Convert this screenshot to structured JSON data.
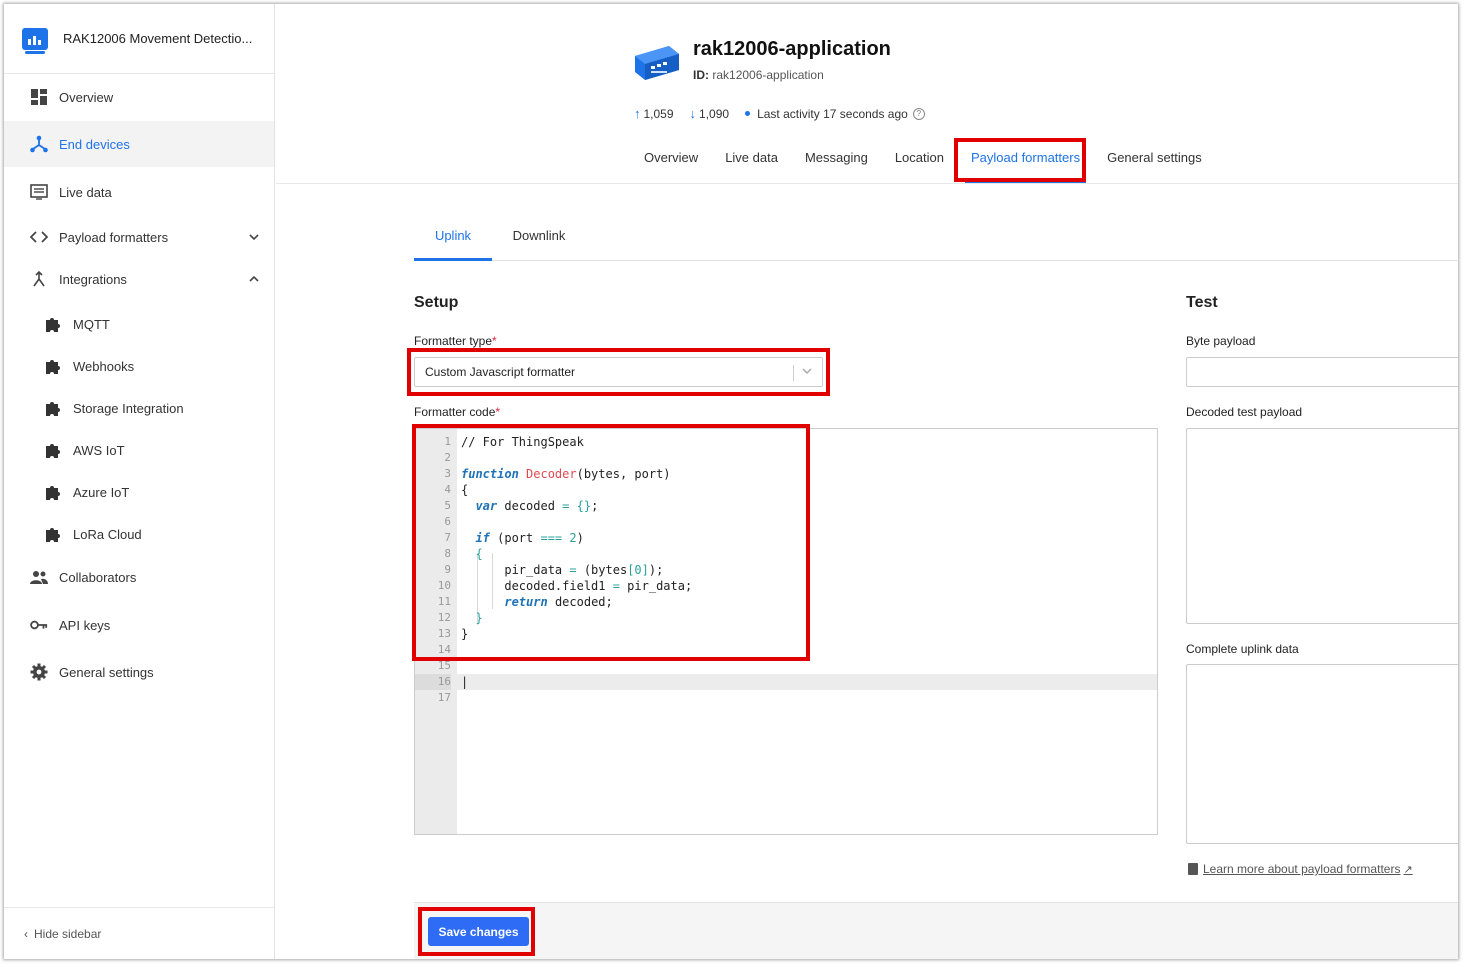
{
  "sidebar": {
    "app_name": "RAK12006 Movement Detectio...",
    "items": [
      {
        "label": "Overview",
        "icon": "dashboard-icon"
      },
      {
        "label": "End devices",
        "icon": "end-devices-icon"
      },
      {
        "label": "Live data",
        "icon": "live-data-icon"
      },
      {
        "label": "Payload formatters",
        "icon": "code-icon"
      },
      {
        "label": "Integrations",
        "icon": "integrations-icon"
      }
    ],
    "integrations": [
      {
        "label": "MQTT",
        "icon": "puzzle-icon"
      },
      {
        "label": "Webhooks",
        "icon": "puzzle-icon"
      },
      {
        "label": "Storage Integration",
        "icon": "puzzle-icon"
      },
      {
        "label": "AWS IoT",
        "icon": "puzzle-icon"
      },
      {
        "label": "Azure IoT",
        "icon": "puzzle-icon"
      },
      {
        "label": "LoRa Cloud",
        "icon": "puzzle-icon"
      }
    ],
    "bottom_items": [
      {
        "label": "Collaborators",
        "icon": "people-icon"
      },
      {
        "label": "API keys",
        "icon": "key-icon"
      },
      {
        "label": "General settings",
        "icon": "gear-icon"
      }
    ],
    "hide_label": "Hide sidebar"
  },
  "header": {
    "title": "rak12006-application",
    "id_label": "ID:",
    "id_value": "rak12006-application",
    "uplink_count": "1,059",
    "downlink_count": "1,090",
    "last_activity": "Last activity 17 seconds ago"
  },
  "tabs": [
    "Overview",
    "Live data",
    "Messaging",
    "Location",
    "Payload formatters",
    "General settings"
  ],
  "subtabs": [
    "Uplink",
    "Downlink"
  ],
  "setup": {
    "heading": "Setup",
    "formatter_type_label": "Formatter type",
    "formatter_type_value": "Custom Javascript formatter",
    "formatter_code_label": "Formatter code",
    "required_mark": "*"
  },
  "code": {
    "line_numbers": [
      "1",
      "2",
      "3",
      "4",
      "5",
      "6",
      "7",
      "8",
      "9",
      "10",
      "11",
      "12",
      "13",
      "14",
      "15",
      "16",
      "17"
    ]
  },
  "test": {
    "heading": "Test",
    "byte_payload_label": "Byte payload",
    "decoded_label": "Decoded test payload",
    "complete_label": "Complete uplink data",
    "learn_more": "Learn more about payload formatters"
  },
  "footer": {
    "save_label": "Save changes"
  },
  "colors": {
    "accent": "#1e73e8",
    "button": "#2e6cf6",
    "highlight": "#e00000"
  }
}
